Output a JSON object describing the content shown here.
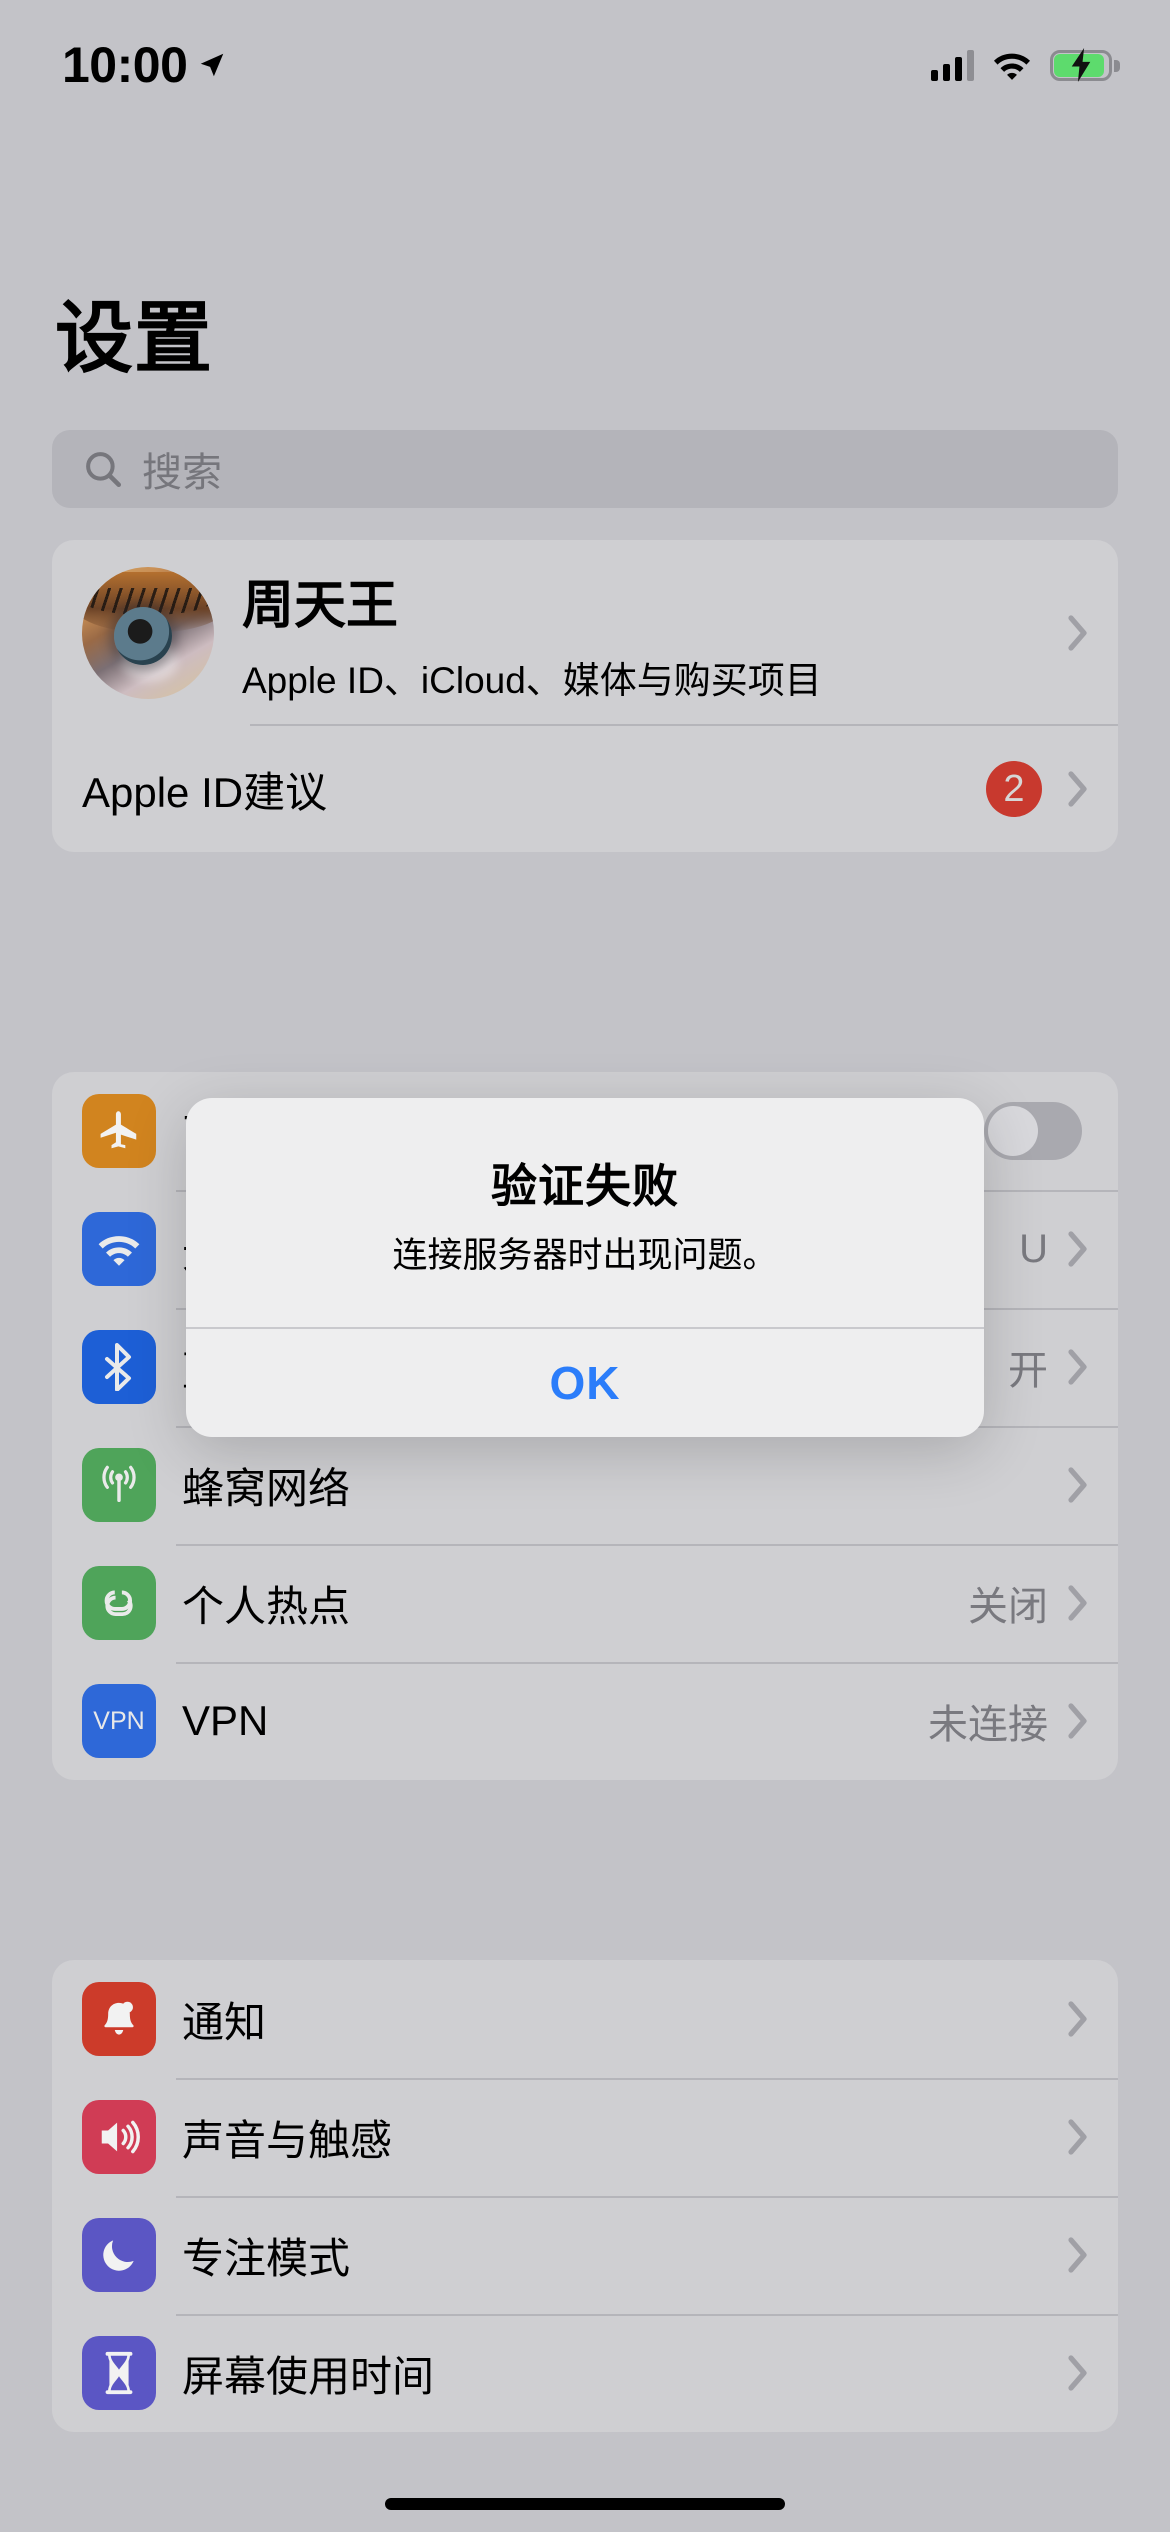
{
  "status_bar": {
    "time": "10:00",
    "location_icon": "location-arrow-icon",
    "signal_icon": "cellular-signal-icon",
    "wifi_icon": "wifi-icon",
    "battery_icon": "battery-charging-icon"
  },
  "header": {
    "title": "设置"
  },
  "search": {
    "placeholder": "搜索",
    "value": "",
    "icon": "search-icon"
  },
  "account": {
    "avatar_icon": "avatar-eye-painting",
    "name": "周天王",
    "subtitle": "Apple ID、iCloud、媒体与购买项目",
    "suggestion": {
      "label": "Apple ID建议",
      "badge": "2",
      "badge_color": "#c8392e"
    }
  },
  "network_rows": [
    {
      "label": "飞行模式",
      "icon": "airplane-icon",
      "icon_color": "#d1841f",
      "control": "toggle",
      "toggle_on": false,
      "value": ""
    },
    {
      "label": "无线局域网",
      "icon": "wifi-icon",
      "icon_color": "#2e68d8",
      "control": "chevron",
      "value": "U"
    },
    {
      "label": "蓝牙",
      "icon": "bluetooth-icon",
      "icon_color": "#1d5fd6",
      "control": "chevron",
      "value": "开"
    },
    {
      "label": "蜂窝网络",
      "icon": "cellular-antenna-icon",
      "icon_color": "#4fa45a",
      "control": "chevron",
      "value": ""
    },
    {
      "label": "个人热点",
      "icon": "hotspot-link-icon",
      "icon_color": "#4fa45a",
      "control": "chevron",
      "value": "关闭"
    },
    {
      "label": "VPN",
      "icon": "vpn-icon",
      "icon_color": "#2e68d8",
      "icon_text": "VPN",
      "control": "chevron",
      "value": "未连接"
    }
  ],
  "system_rows": [
    {
      "label": "通知",
      "icon": "bell-icon",
      "icon_color": "#cc3b2a",
      "value": ""
    },
    {
      "label": "声音与触感",
      "icon": "speaker-icon",
      "icon_color": "#d03c55",
      "value": ""
    },
    {
      "label": "专注模式",
      "icon": "moon-icon",
      "icon_color": "#5b56c4",
      "value": ""
    },
    {
      "label": "屏幕使用时间",
      "icon": "hourglass-icon",
      "icon_color": "#5b56c4",
      "value": ""
    }
  ],
  "alert": {
    "title": "验证失败",
    "message": "连接服务器时出现问题。",
    "ok_label": "OK",
    "accent_color": "#2b7dfa"
  }
}
